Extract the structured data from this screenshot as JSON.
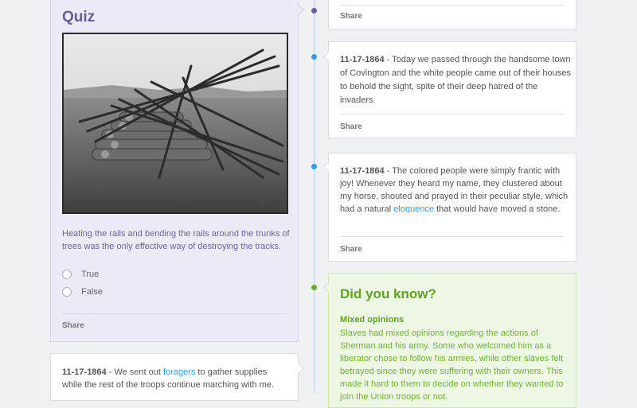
{
  "quiz": {
    "title": "Quiz",
    "image_alt": "Rails stacked over burning ties",
    "question": "Heating the rails and bending the rails around the trunks of trees was the only effective way of destroying the tracks.",
    "options": [
      "True",
      "False"
    ],
    "share": "Share"
  },
  "entries": [
    {
      "share": "Share"
    },
    {
      "date": "11-17-1864",
      "text": " - Today we passed through the handsome town of Covington and the white people came out of their houses to behold the sight, spite of their deep hatred of the invaders.",
      "share": "Share"
    },
    {
      "date": "11-17-1864",
      "text_before": " - The colored people were simply frantic with joy! Whenever they heard my name, they clustered about my horse, shouted and prayed in their peculiar style, which had a natural ",
      "link": "eloquence",
      "text_after": " that would have moved a stone.",
      "share": "Share"
    }
  ],
  "left_entry": {
    "date": "11-17-1864",
    "text_before": " - We sent out ",
    "link": "foragers",
    "text_after": " to gather supplies while the rest of the troops continue marching with me."
  },
  "did_you_know": {
    "title": "Did you know?",
    "subtitle": "Mixed opinions",
    "body": "Slaves had mixed opinions regarding the actions of Sherman and his army. Some who welcomed him as a liberator chose to follow his armies, while other slaves felt betrayed since they were suffering with their owners. This made it hard to them to decide on whether they wanted to join the Union troops or not."
  },
  "colors": {
    "quiz_accent": "#685c99",
    "link": "#2f9ee6",
    "did_you_know": "#5fa320",
    "timeline": "#c8e3f6"
  }
}
